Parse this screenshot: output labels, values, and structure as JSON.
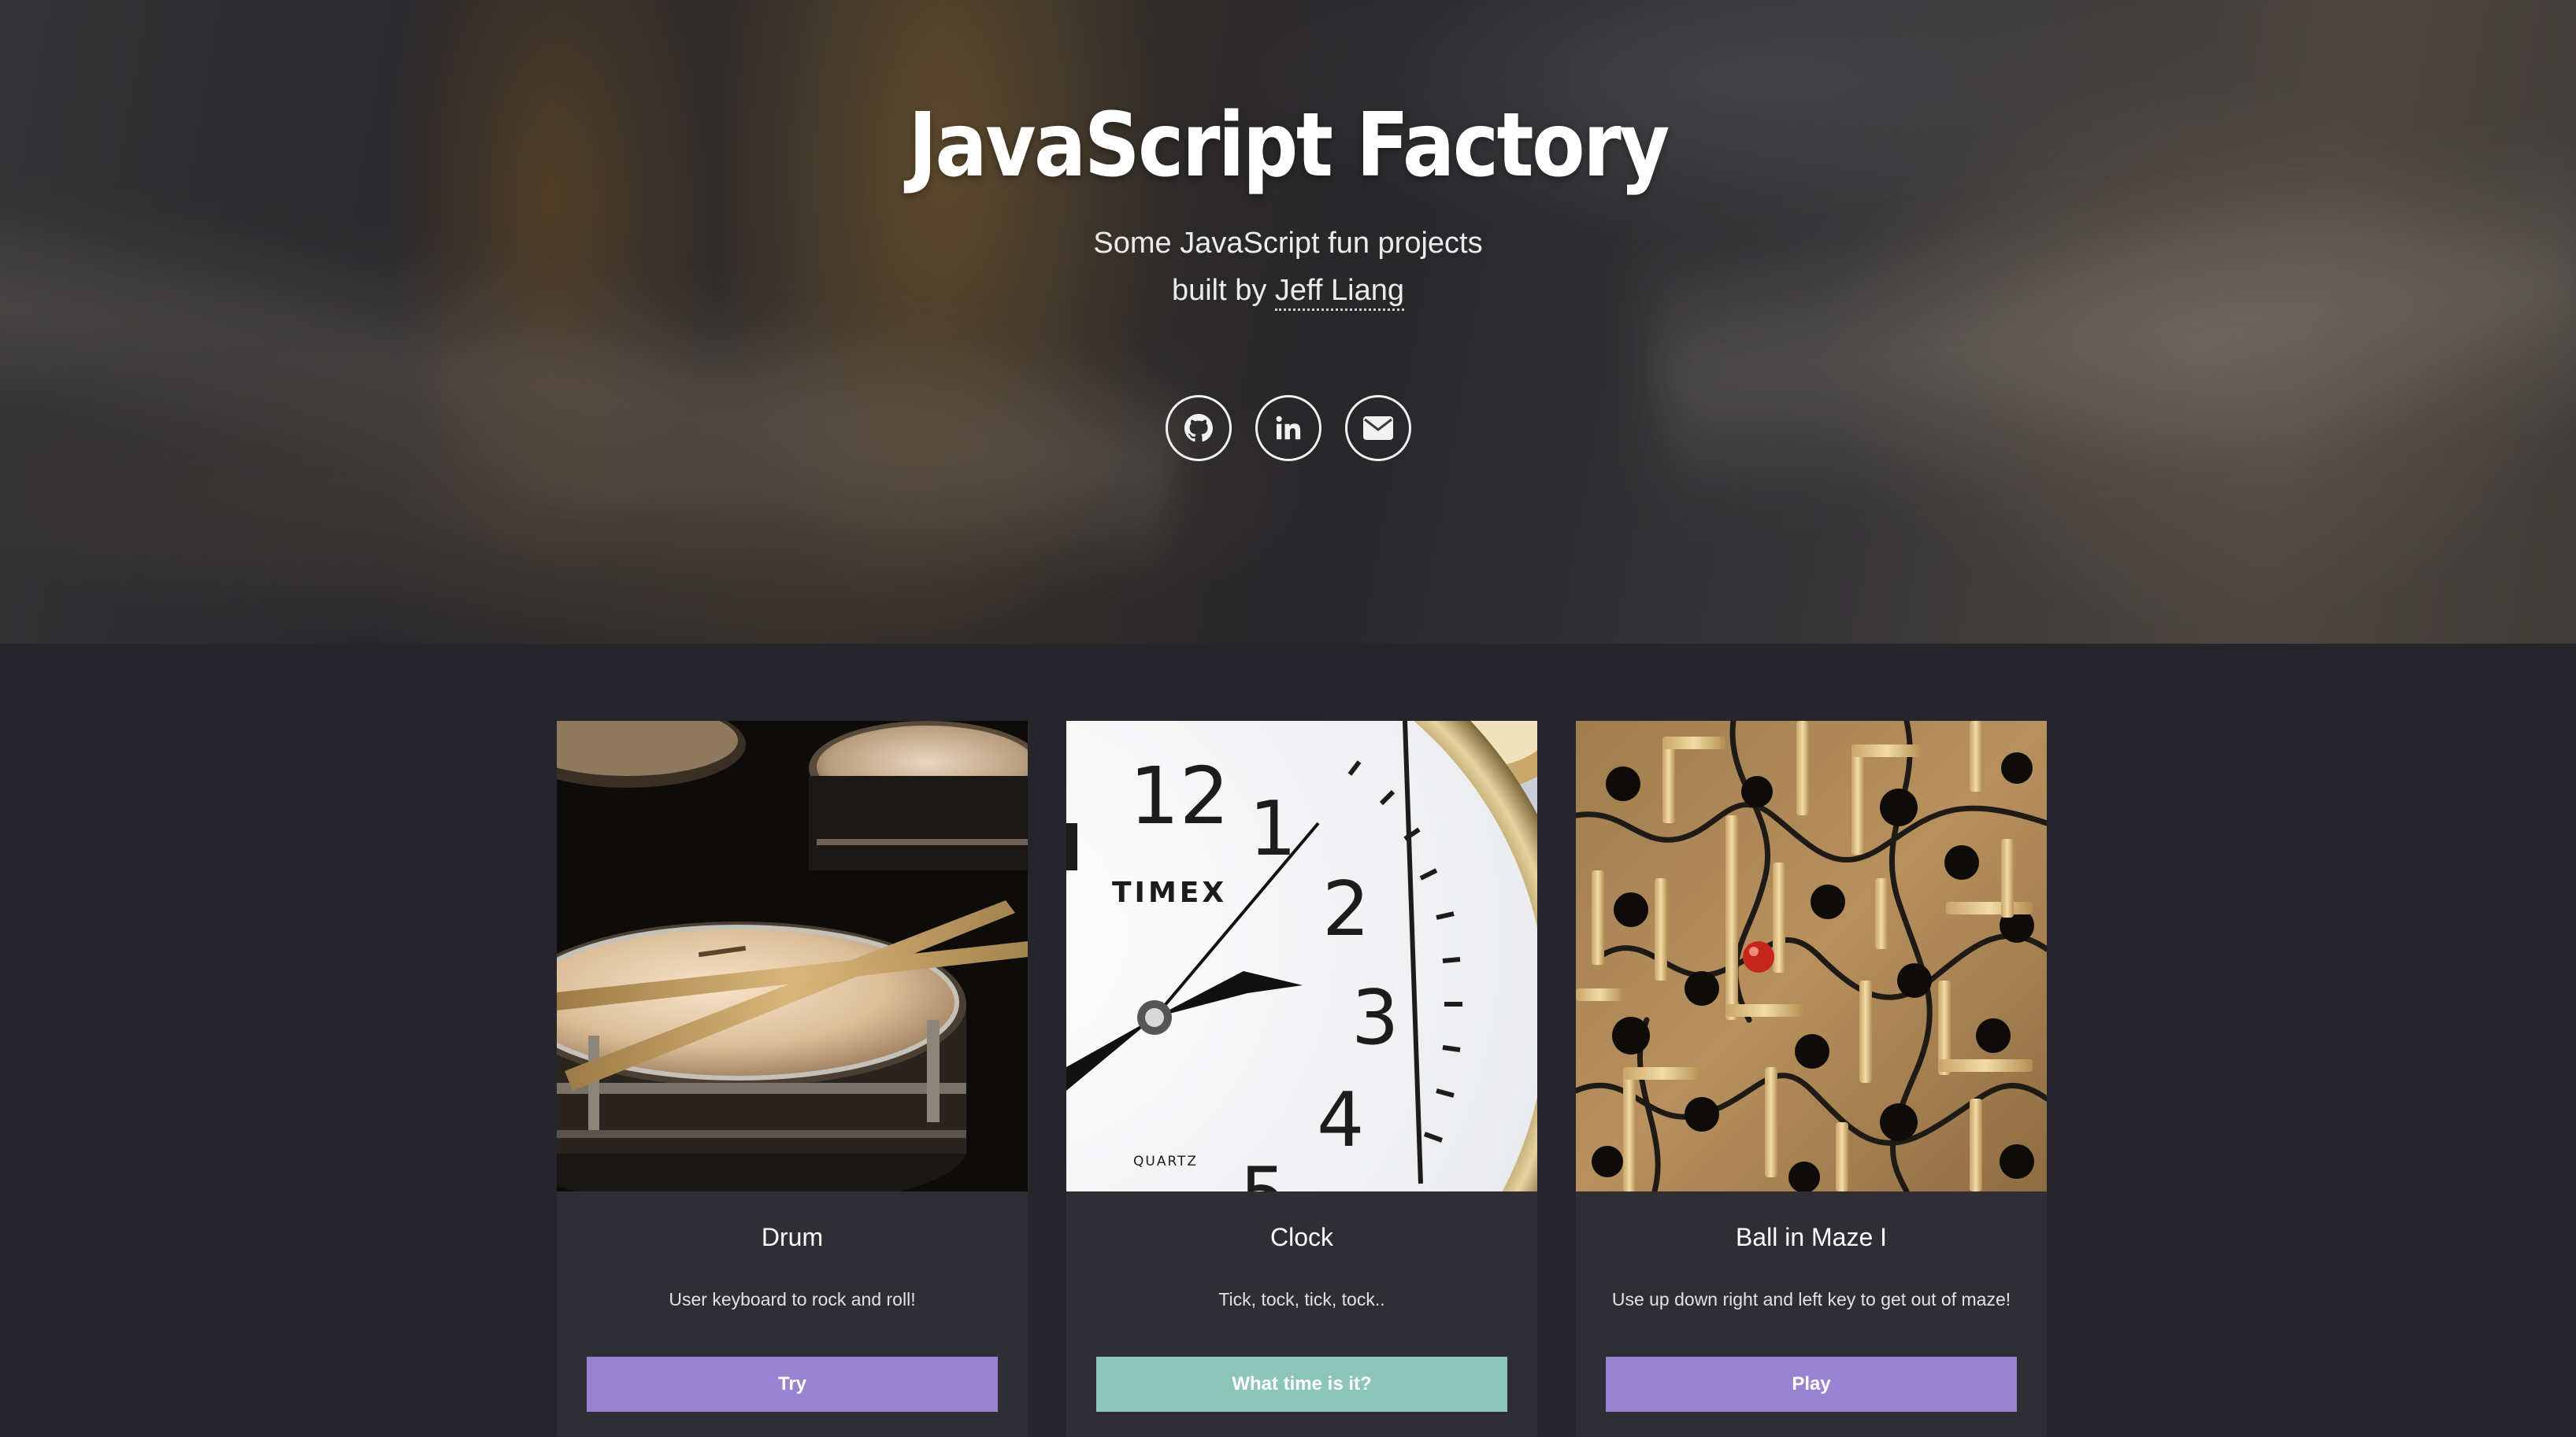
{
  "hero": {
    "title": "JavaScript Factory",
    "subtitle": "Some JavaScript fun projects",
    "byline_prefix": "built by ",
    "author": "Jeff Liang",
    "social": [
      {
        "icon": "github-icon"
      },
      {
        "icon": "linkedin-icon"
      },
      {
        "icon": "envelope-icon"
      }
    ]
  },
  "projects": [
    {
      "title": "Drum",
      "description": "User keyboard to rock and roll!",
      "button": "Try",
      "button_color": "#9783d2"
    },
    {
      "title": "Clock",
      "description": "Tick, tock, tick, tock..",
      "button": "What time is it?",
      "button_color": "#8dc5b8",
      "image_text": {
        "n12": "12",
        "n1": "1",
        "n2": "2",
        "n3": "3",
        "n4": "4",
        "n5": "5",
        "brand": "TIMEX",
        "model": "QUARTZ"
      }
    },
    {
      "title": "Ball in Maze I",
      "description": "Use up down right and left key to get out of maze!",
      "button": "Play",
      "button_color": "#9783d2"
    }
  ],
  "colors": {
    "page_bg": "#26252b",
    "card_bg": "#2f2e34",
    "accent_purple": "#9783d2",
    "accent_teal": "#8dc5b8"
  }
}
